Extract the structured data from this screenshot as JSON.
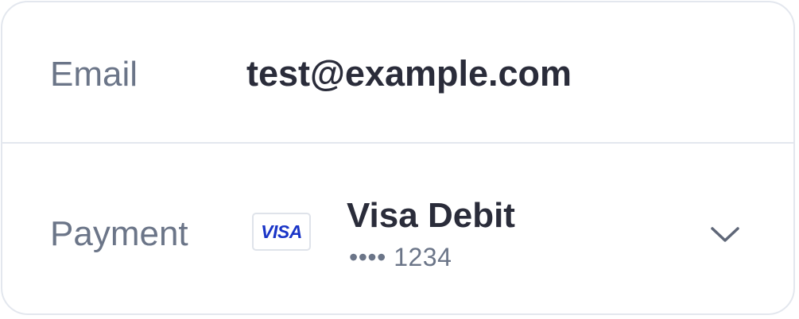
{
  "email": {
    "label": "Email",
    "value": "test@example.com"
  },
  "payment": {
    "label": "Payment",
    "card_brand": "VISA",
    "card_brand_color": "#1a35c7",
    "card_name": "Visa Debit",
    "card_number": "•••• 1234",
    "chevron_icon": "chevron-down-icon"
  },
  "colors": {
    "label": "#6b7588",
    "value": "#2a2c3a",
    "border": "#e3e7ee"
  }
}
